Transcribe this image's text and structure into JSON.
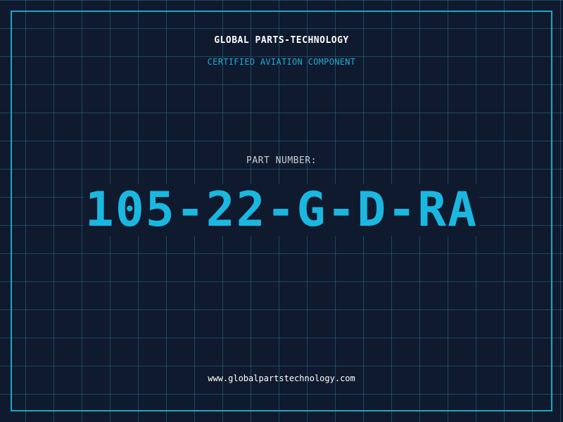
{
  "header": {
    "company_name": "GLOBAL PARTS-TECHNOLOGY",
    "tagline": "CERTIFIED AVIATION COMPONENT"
  },
  "part": {
    "label": "PART NUMBER:",
    "number": "105-22-G-D-RA"
  },
  "footer": {
    "website": "www.globalpartstechnology.com"
  },
  "colors": {
    "background": "#0f1a2e",
    "grid": "#266e8c",
    "accent": "#1ab8e0",
    "frame": "#1aa6cc",
    "text_primary": "#ffffff",
    "text_secondary": "#c9cdd4"
  }
}
